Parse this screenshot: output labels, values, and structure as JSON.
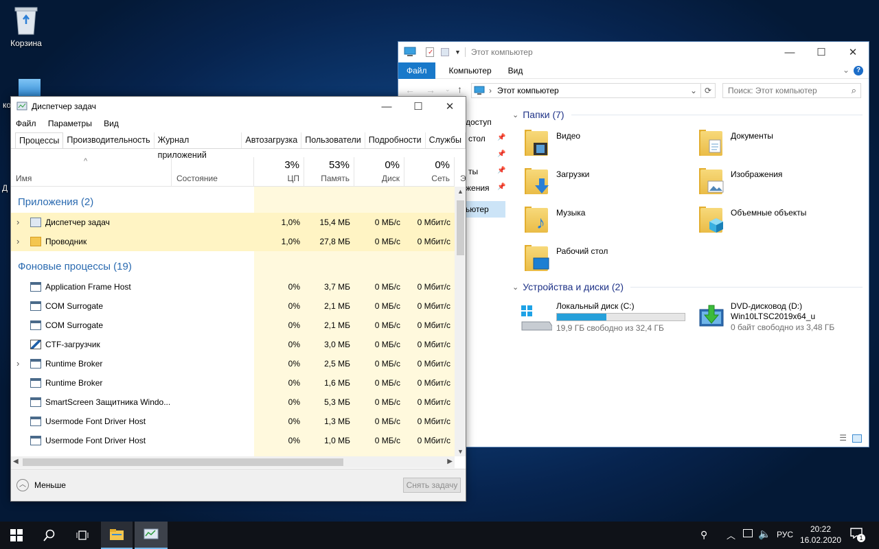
{
  "desktop": {
    "recycle_bin": "Корзина",
    "cut_icon": "ко",
    "left_edge": "Д"
  },
  "explorer": {
    "title": "Этот компьютер",
    "ribbon": [
      "Файл",
      "Компьютер",
      "Вид"
    ],
    "address": "Этот компьютер",
    "search_placeholder": "Поиск: Этот компьютер",
    "nav": [
      "доступ",
      "стол",
      "ты",
      "жения",
      "ьютер"
    ],
    "folders_header": "Папки (7)",
    "folders": [
      "Видео",
      "Документы",
      "Загрузки",
      "Изображения",
      "Музыка",
      "Объемные объекты",
      "Рабочий стол"
    ],
    "devices_header": "Устройства и диски (2)",
    "disk_c": {
      "name": "Локальный диск (C:)",
      "free": "19,9 ГБ свободно из 32,4 ГБ",
      "used_fraction": 0.386
    },
    "dvd": {
      "name": "DVD-дисковод (D:)",
      "label": "Win10LTSC2019x64_u",
      "free": "0 байт свободно из 3,48 ГБ"
    }
  },
  "taskmgr": {
    "title": "Диспетчер задач",
    "menu": [
      "Файл",
      "Параметры",
      "Вид"
    ],
    "tabs": [
      "Процессы",
      "Производительность",
      "Журнал приложений",
      "Автозагрузка",
      "Пользователи",
      "Подробности",
      "Службы"
    ],
    "col_name": "Имя",
    "col_status": "Состояние",
    "cpu_pct": "3%",
    "cpu": "ЦП",
    "mem_pct": "53%",
    "mem": "Память",
    "disk_pct": "0%",
    "disk": "Диск",
    "net_pct": "0%",
    "net": "Сеть",
    "cut_col": "Э",
    "apps_group": "Приложения (2)",
    "bg_group": "Фоновые процессы (19)",
    "apps": [
      {
        "name": "Диспетчер задач",
        "cpu": "1,0%",
        "mem": "15,4 МБ",
        "disk": "0 МБ/с",
        "net": "0 Мбит/с"
      },
      {
        "name": "Проводник",
        "cpu": "1,0%",
        "mem": "27,8 МБ",
        "disk": "0 МБ/с",
        "net": "0 Мбит/с"
      }
    ],
    "bg": [
      {
        "name": "Application Frame Host",
        "cpu": "0%",
        "mem": "3,7 МБ",
        "disk": "0 МБ/с",
        "net": "0 Мбит/с"
      },
      {
        "name": "COM Surrogate",
        "cpu": "0%",
        "mem": "2,1 МБ",
        "disk": "0 МБ/с",
        "net": "0 Мбит/с"
      },
      {
        "name": "COM Surrogate",
        "cpu": "0%",
        "mem": "2,1 МБ",
        "disk": "0 МБ/с",
        "net": "0 Мбит/с"
      },
      {
        "name": "CTF-загрузчик",
        "cpu": "0%",
        "mem": "3,0 МБ",
        "disk": "0 МБ/с",
        "net": "0 Мбит/с"
      },
      {
        "name": "Runtime Broker",
        "cpu": "0%",
        "mem": "2,5 МБ",
        "disk": "0 МБ/с",
        "net": "0 Мбит/с"
      },
      {
        "name": "Runtime Broker",
        "cpu": "0%",
        "mem": "1,6 МБ",
        "disk": "0 МБ/с",
        "net": "0 Мбит/с"
      },
      {
        "name": "SmartScreen Защитника Windo...",
        "cpu": "0%",
        "mem": "5,3 МБ",
        "disk": "0 МБ/с",
        "net": "0 Мбит/с"
      },
      {
        "name": "Usermode Font Driver Host",
        "cpu": "0%",
        "mem": "1,3 МБ",
        "disk": "0 МБ/с",
        "net": "0 Мбит/с"
      },
      {
        "name": "Usermode Font Driver Host",
        "cpu": "0%",
        "mem": "1,0 МБ",
        "disk": "0 МБ/с",
        "net": "0 Мбит/с"
      }
    ],
    "less": "Меньше",
    "end_task": "Снять задачу"
  },
  "taskbar": {
    "lang": "РУС",
    "time": "20:22",
    "date": "16.02.2020",
    "notif_count": "1"
  }
}
